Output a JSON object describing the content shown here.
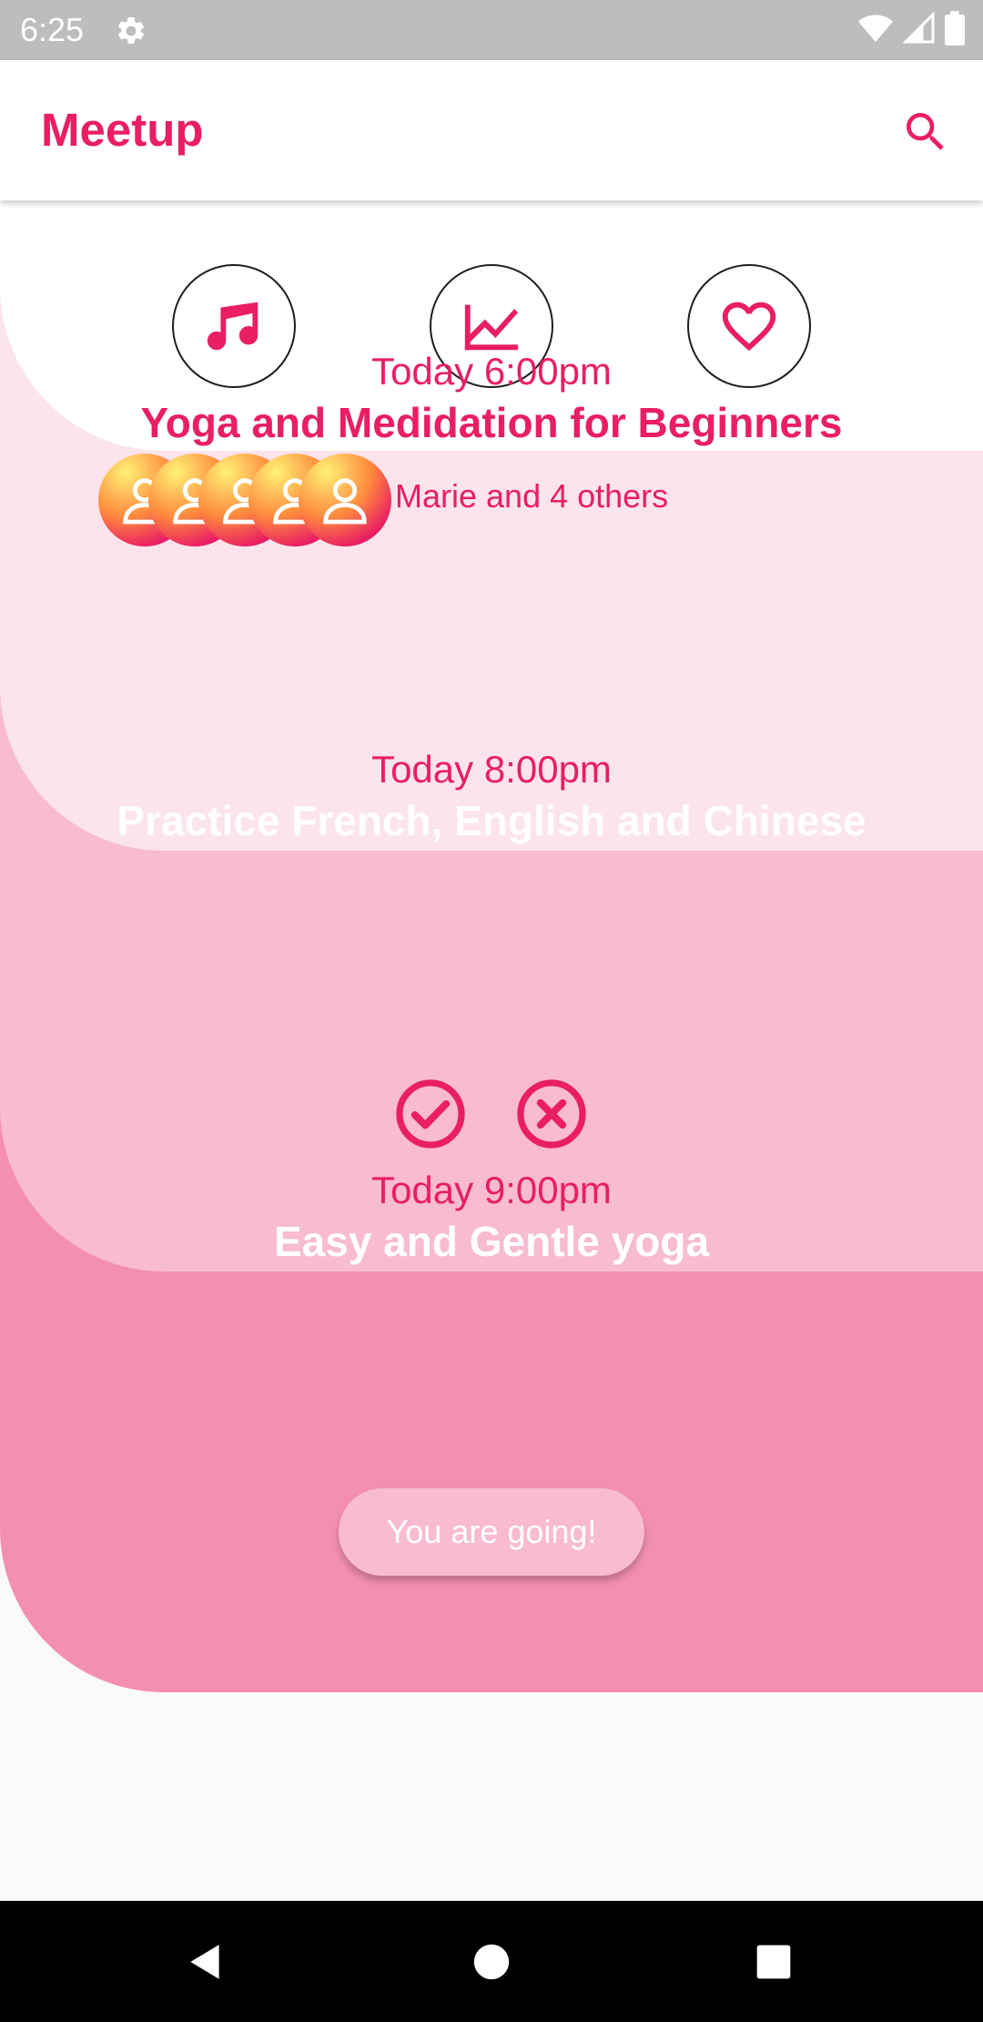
{
  "status_bar": {
    "time": "6:25",
    "icons": [
      "settings-icon",
      "wifi-icon",
      "signal-icon",
      "battery-icon"
    ]
  },
  "app_bar": {
    "title": "Meetup",
    "search_icon": "search-icon"
  },
  "categories": [
    {
      "icon": "music-note-icon"
    },
    {
      "icon": "trending-up-icon"
    },
    {
      "icon": "heart-icon"
    }
  ],
  "events": [
    {
      "time": "Today 6:00pm",
      "title": "Yoga and Medidation for Beginners",
      "attendees_text": "Marie and 4 others",
      "attendee_avatar_count": 5
    },
    {
      "time": "Today 8:00pm",
      "title": "Practice French, English and Chinese",
      "actions": [
        "check-circle-icon",
        "cancel-circle-icon"
      ]
    },
    {
      "time": "Today 9:00pm",
      "title": "Easy and Gentle yoga",
      "status_button": "You are going!"
    }
  ],
  "colors": {
    "accent": "#e91e63",
    "section_1": "#fce4ec",
    "section_2": "#f8bbd0",
    "section_3": "#f48fb1",
    "status_bar": "#bdbdbd",
    "nav_bar": "#000000"
  },
  "nav_bar": {
    "icons": [
      "back-icon",
      "home-icon",
      "recents-icon"
    ]
  }
}
